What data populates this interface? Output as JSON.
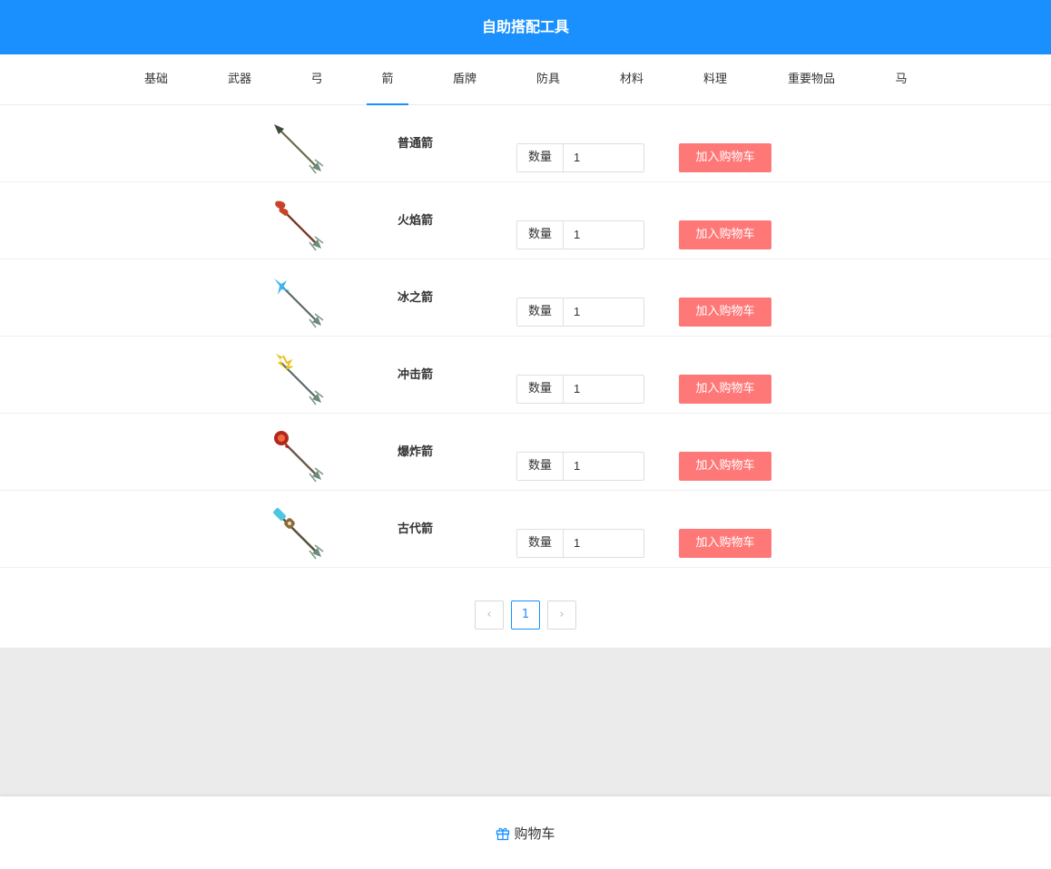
{
  "header": {
    "title": "自助搭配工具"
  },
  "tabs": [
    {
      "label": "基础"
    },
    {
      "label": "武器"
    },
    {
      "label": "弓"
    },
    {
      "label": "箭"
    },
    {
      "label": "盾牌"
    },
    {
      "label": "防具"
    },
    {
      "label": "材料"
    },
    {
      "label": "料理"
    },
    {
      "label": "重要物品"
    },
    {
      "label": "马"
    }
  ],
  "active_tab": "箭",
  "items": [
    {
      "name": "普通箭",
      "qty_label": "数量",
      "qty_value": "1",
      "button": "加入购物车",
      "icon": "normal-arrow-icon"
    },
    {
      "name": "火焰箭",
      "qty_label": "数量",
      "qty_value": "1",
      "button": "加入购物车",
      "icon": "fire-arrow-icon"
    },
    {
      "name": "冰之箭",
      "qty_label": "数量",
      "qty_value": "1",
      "button": "加入购物车",
      "icon": "ice-arrow-icon"
    },
    {
      "name": "冲击箭",
      "qty_label": "数量",
      "qty_value": "1",
      "button": "加入购物车",
      "icon": "shock-arrow-icon"
    },
    {
      "name": "爆炸箭",
      "qty_label": "数量",
      "qty_value": "1",
      "button": "加入购物车",
      "icon": "bomb-arrow-icon"
    },
    {
      "name": "古代箭",
      "qty_label": "数量",
      "qty_value": "1",
      "button": "加入购物车",
      "icon": "ancient-arrow-icon"
    }
  ],
  "pagination": {
    "current": "1",
    "prev": "‹",
    "next": "›"
  },
  "footer": {
    "cart_label": "购物车",
    "icon": "gift-icon"
  },
  "colors": {
    "primary": "#1a90ff",
    "add_button": "#ff7878",
    "background": "#ebebeb"
  }
}
